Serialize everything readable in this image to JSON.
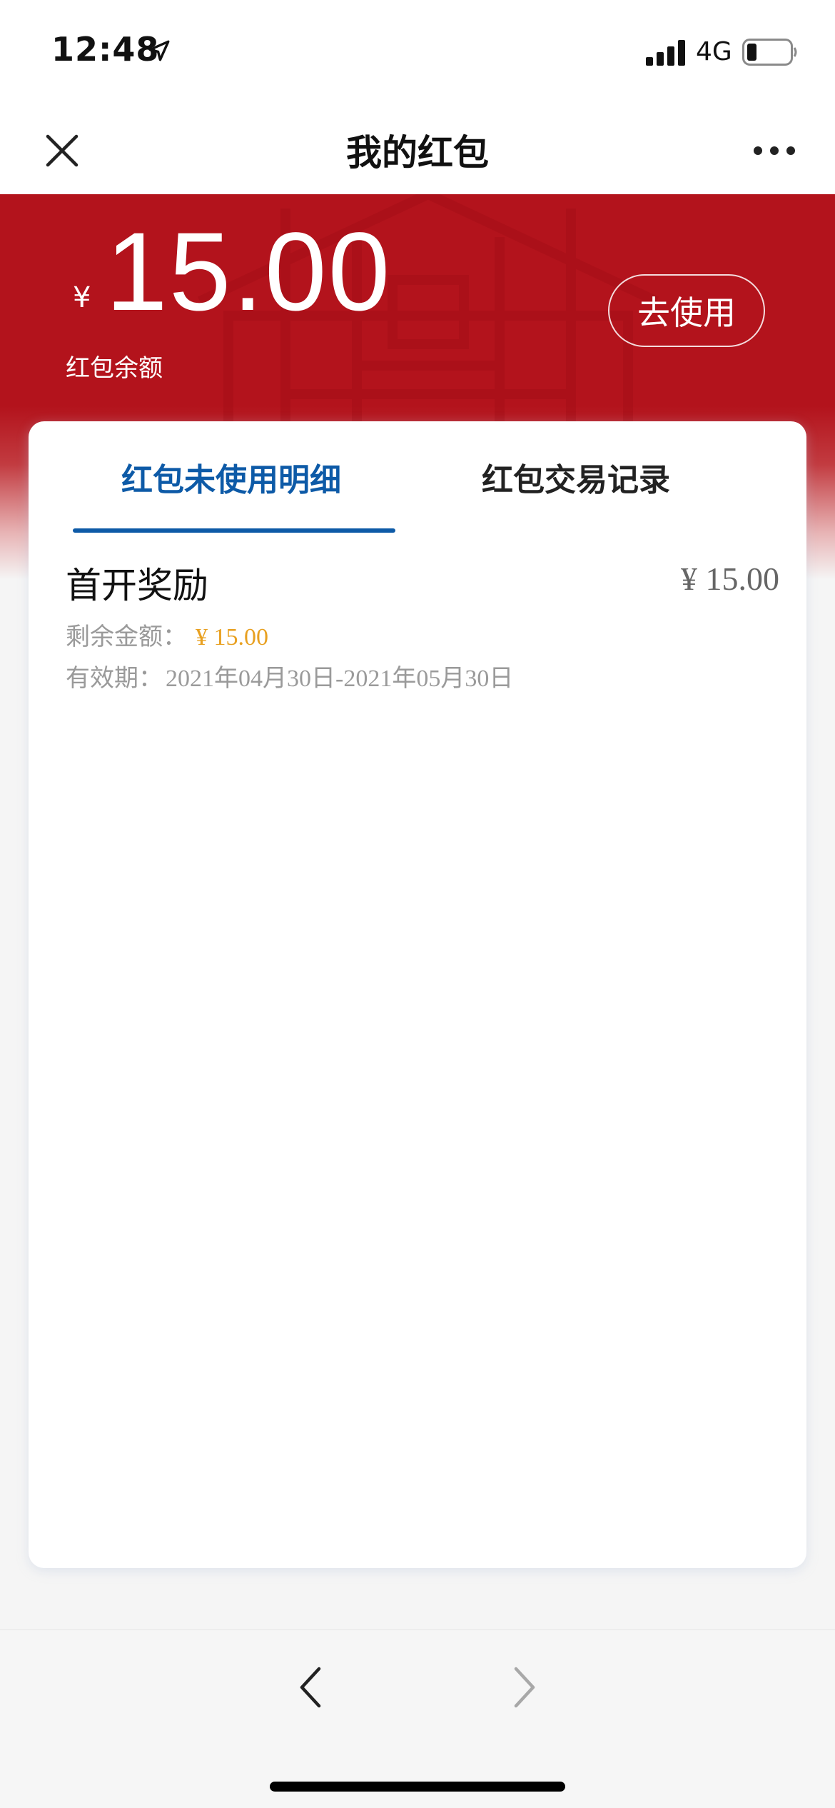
{
  "status_bar": {
    "time": "12:48",
    "network": "4G",
    "icons": [
      "location-arrow-icon",
      "signal-bars-icon",
      "battery-icon"
    ]
  },
  "nav": {
    "title": "我的红包",
    "icons": [
      "close-icon",
      "more-icon"
    ]
  },
  "header": {
    "currency_symbol": "¥",
    "balance": "15.00",
    "balance_label": "红包余额",
    "use_button_label": "去使用",
    "accent_color": "#b3131c"
  },
  "tabs": [
    {
      "label": "红包未使用明细",
      "active": true
    },
    {
      "label": "红包交易记录",
      "active": false
    }
  ],
  "items": [
    {
      "title": "首开奖励",
      "amount": "¥ 15.00",
      "remain_label": "剩余金额：",
      "remain_value": "¥ 15.00",
      "validity_label": "有效期：",
      "validity_value": "2021年04月30日-2021年05月30日"
    }
  ],
  "bottom_bar": {
    "icons": [
      "chevron-left-icon",
      "chevron-right-icon"
    ]
  },
  "colors": {
    "tab_active": "#0d5aa7",
    "remain_value": "#e8a020"
  }
}
